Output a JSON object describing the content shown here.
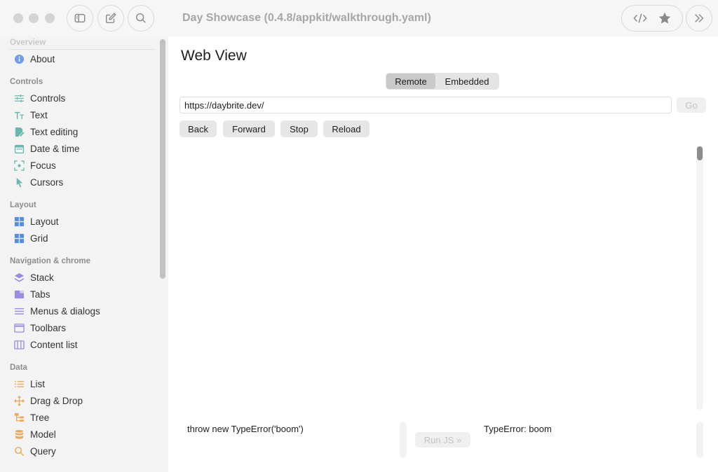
{
  "window": {
    "title": "Day Showcase (0.4.8/appkit/walkthrough.yaml)"
  },
  "toolbar": {
    "left_buttons": [
      "sidebar-toggle-icon",
      "compose-icon",
      "search-icon"
    ],
    "right_buttons": [
      "code-icon",
      "star-icon"
    ],
    "overflow": "chevron-double-right-icon"
  },
  "sidebar": {
    "overview_section": "Overview",
    "about": "About",
    "controls_section": "Controls",
    "controls_items": [
      {
        "label": "Controls",
        "icon": "sliders-icon"
      },
      {
        "label": "Text",
        "icon": "text-size-icon"
      },
      {
        "label": "Text editing",
        "icon": "doc-edit-icon"
      },
      {
        "label": "Date & time",
        "icon": "calendar-icon"
      },
      {
        "label": "Focus",
        "icon": "focus-icon"
      },
      {
        "label": "Cursors",
        "icon": "cursor-icon"
      }
    ],
    "layout_section": "Layout",
    "layout_items": [
      {
        "label": "Layout",
        "icon": "layout-grid-icon"
      },
      {
        "label": "Grid",
        "icon": "grid-icon"
      }
    ],
    "nav_section": "Navigation & chrome",
    "nav_items": [
      {
        "label": "Stack",
        "icon": "stack-icon"
      },
      {
        "label": "Tabs",
        "icon": "tabs-icon"
      },
      {
        "label": "Menus & dialogs",
        "icon": "menu-lines-icon"
      },
      {
        "label": "Toolbars",
        "icon": "toolbar-window-icon"
      },
      {
        "label": "Content list",
        "icon": "columns-icon"
      }
    ],
    "data_section": "Data",
    "data_items": [
      {
        "label": "List",
        "icon": "list-icon"
      },
      {
        "label": "Drag & Drop",
        "icon": "move-arrows-icon"
      },
      {
        "label": "Tree",
        "icon": "tree-icon"
      },
      {
        "label": "Model",
        "icon": "database-icon"
      },
      {
        "label": "Query",
        "icon": "magnifier-icon"
      }
    ]
  },
  "main": {
    "title": "Web View",
    "segments": [
      "Remote",
      "Embedded"
    ],
    "selected_segment": "Remote",
    "url_value": "https://daybrite.dev/",
    "go_label": "Go",
    "nav_buttons": [
      "Back",
      "Forward",
      "Stop",
      "Reload"
    ],
    "js_input": "throw new TypeError('boom')",
    "run_label": "Run JS »",
    "js_output": "TypeError: boom"
  },
  "colors": {
    "sidebar_bg": "#f3f3f3",
    "titlebar_bg": "#f6f6f6",
    "blue_icon": "#4f8de8",
    "teal_icon": "#6ab8b0",
    "purple_icon": "#9a8de0",
    "orange_icon": "#e9a85a"
  }
}
